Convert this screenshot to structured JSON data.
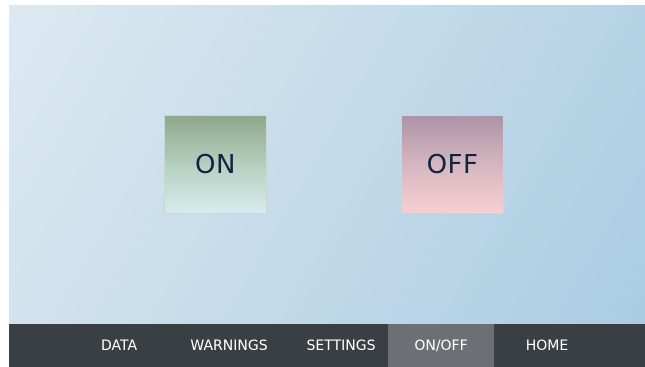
{
  "panel": {
    "on_label": "ON",
    "off_label": "OFF"
  },
  "nav": {
    "items": [
      {
        "label": "DATA",
        "active": false
      },
      {
        "label": "WARNINGS",
        "active": false
      },
      {
        "label": "SETTINGS",
        "active": false
      },
      {
        "label": "ON/OFF",
        "active": true
      },
      {
        "label": "HOME",
        "active": false
      }
    ]
  },
  "colors": {
    "nav_bg": "#3a3f44",
    "nav_active_bg": "#6c7074",
    "on_button_top": "#8ea88c",
    "off_button_top": "#ad93a6"
  }
}
